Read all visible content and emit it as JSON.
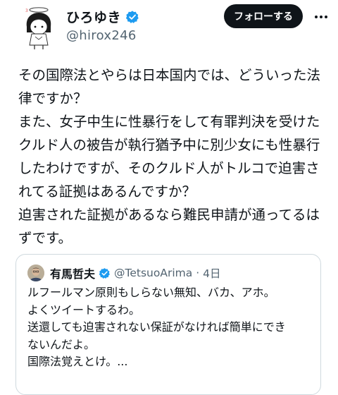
{
  "author": {
    "display_name": "ひろゆき",
    "handle": "@hirox246",
    "follow_label": "フォローする"
  },
  "tweet": {
    "lines": [
      "その国際法とやらは日本国内では、どういった法",
      "律ですか？",
      "また、女子中生に性暴行をして有罪判決を受けた",
      "クルド人の被告が執行猶予中に別少女にも性暴行",
      "したわけですが、そのクルド人がトルコで迫害さ",
      "れてる証拠はあるんですか？",
      "迫害された証拠があるなら難民申請が通ってるは",
      "ずです。"
    ]
  },
  "quoted_tweet": {
    "display_name": "有馬哲夫",
    "handle": "@TetsuoArima",
    "separator": "·",
    "time": "4日",
    "lines": [
      "ルフールマン原則もしらない無知、バカ、アホ。",
      "よくツイートするわ。",
      "送還しても迫害されない保証がなければ簡単にでき",
      "ないんだよ。",
      "国際法覚えとけ。..."
    ]
  },
  "colors": {
    "verified": "#1d9bf0",
    "follow_bg": "#0f1419",
    "secondary_text": "#536471",
    "border": "#cfd9de"
  },
  "icons": {
    "verified": "verified-badge-icon",
    "more": "more-options-icon"
  }
}
